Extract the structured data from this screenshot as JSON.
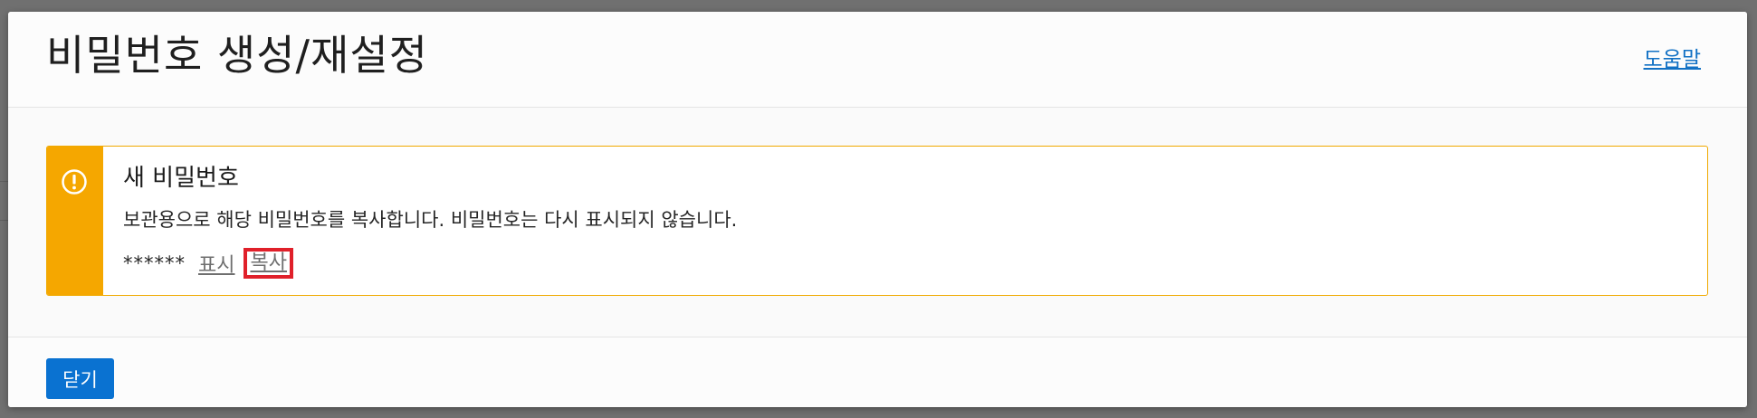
{
  "dialog": {
    "title": "비밀번호 생성/재설정",
    "help_label": "도움말"
  },
  "message": {
    "icon": "exclamation-circle-icon",
    "title": "새 비밀번호",
    "text": "보관용으로 해당 비밀번호를 복사합니다. 비밀번호는 다시 표시되지 않습니다.",
    "password_mask": "******",
    "show_label": "표시",
    "copy_label": "복사"
  },
  "footer": {
    "close_label": "닫기"
  },
  "colors": {
    "accent": "#0a72d1",
    "warning": "#f5a700",
    "highlight": "#e0202a",
    "link": "#1271c4"
  }
}
